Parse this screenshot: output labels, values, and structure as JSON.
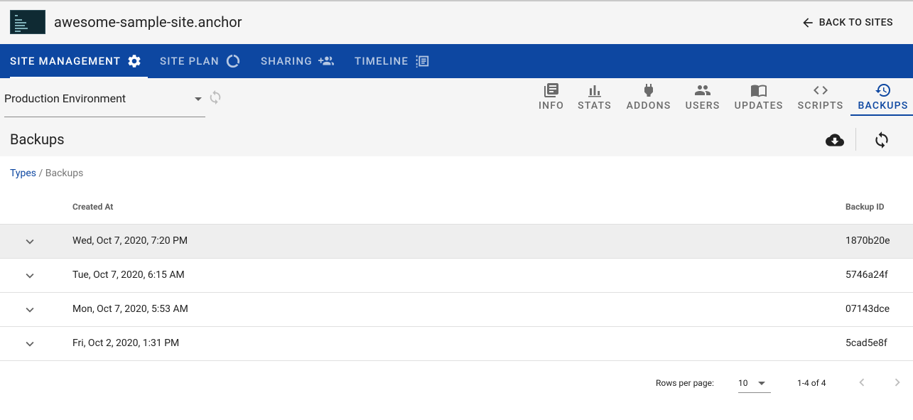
{
  "site": {
    "name": "awesome-sample-site.anchor",
    "back_label": "BACK TO SITES"
  },
  "nav": {
    "tabs": [
      {
        "label": "SITE MANAGEMENT",
        "icon": "gear-icon",
        "active": true
      },
      {
        "label": "SITE PLAN",
        "icon": "donut-icon",
        "active": false
      },
      {
        "label": "SHARING",
        "icon": "group-add-icon",
        "active": false
      },
      {
        "label": "TIMELINE",
        "icon": "timeline-icon",
        "active": false
      }
    ]
  },
  "environment": {
    "selected": "Production Environment"
  },
  "subtabs": [
    {
      "label": "INFO",
      "icon": "library-books-icon"
    },
    {
      "label": "STATS",
      "icon": "bar-chart-icon"
    },
    {
      "label": "ADDONS",
      "icon": "plug-icon"
    },
    {
      "label": "USERS",
      "icon": "users-icon"
    },
    {
      "label": "UPDATES",
      "icon": "book-open-icon"
    },
    {
      "label": "SCRIPTS",
      "icon": "code-icon"
    },
    {
      "label": "BACKUPS",
      "icon": "history-icon",
      "active": true
    }
  ],
  "backups": {
    "title": "Backups",
    "breadcrumb": {
      "link": "Types",
      "separator": " / ",
      "current": "Backups"
    },
    "columns": {
      "created_at": "Created At",
      "backup_id": "Backup ID"
    },
    "rows": [
      {
        "created_at": "Wed, Oct 7, 2020, 7:20 PM",
        "backup_id": "1870b20e"
      },
      {
        "created_at": "Tue, Oct 7, 2020, 6:15 AM",
        "backup_id": "5746a24f"
      },
      {
        "created_at": "Mon, Oct 7, 2020, 5:53 AM",
        "backup_id": "07143dce"
      },
      {
        "created_at": "Fri, Oct 2, 2020, 1:31 PM",
        "backup_id": "5cad5e8f"
      }
    ]
  },
  "pagination": {
    "rows_per_page_label": "Rows per page:",
    "rows_per_page": "10",
    "range": "1-4 of 4"
  },
  "colors": {
    "primary": "#0d47a1",
    "surface": "#f5f5f5",
    "row_highlight": "#eeeeee"
  }
}
